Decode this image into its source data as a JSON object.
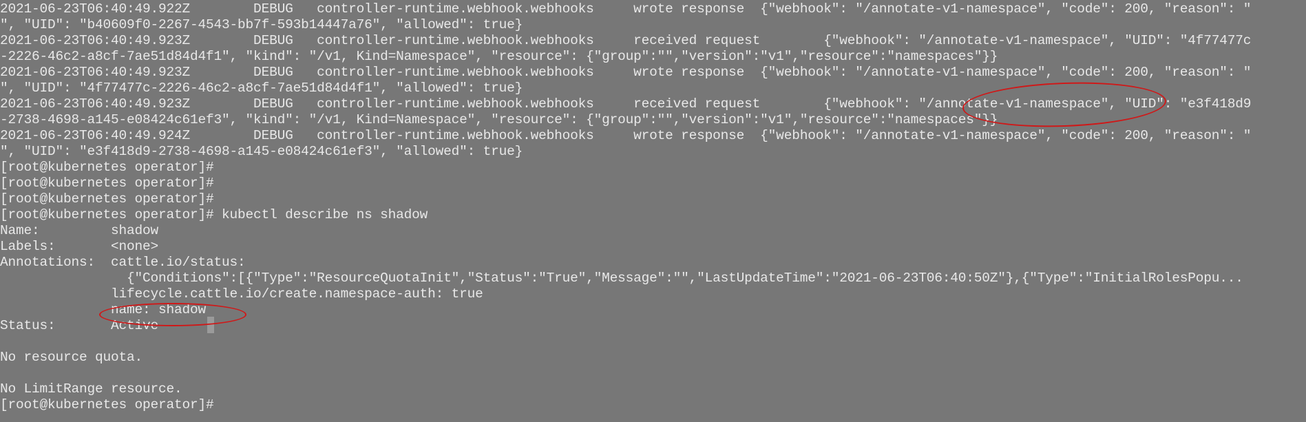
{
  "terminal": {
    "lines": [
      "2021-06-23T06:40:49.922Z        DEBUG   controller-runtime.webhook.webhooks     wrote response  {\"webhook\": \"/annotate-v1-namespace\", \"code\": 200, \"reason\": \"",
      "\", \"UID\": \"b40609f0-2267-4543-bb7f-593b14447a76\", \"allowed\": true}",
      "2021-06-23T06:40:49.923Z        DEBUG   controller-runtime.webhook.webhooks     received request        {\"webhook\": \"/annotate-v1-namespace\", \"UID\": \"4f77477c",
      "-2226-46c2-a8cf-7ae51d84d4f1\", \"kind\": \"/v1, Kind=Namespace\", \"resource\": {\"group\":\"\",\"version\":\"v1\",\"resource\":\"namespaces\"}}",
      "2021-06-23T06:40:49.923Z        DEBUG   controller-runtime.webhook.webhooks     wrote response  {\"webhook\": \"/annotate-v1-namespace\", \"code\": 200, \"reason\": \"",
      "\", \"UID\": \"4f77477c-2226-46c2-a8cf-7ae51d84d4f1\", \"allowed\": true}",
      "2021-06-23T06:40:49.923Z        DEBUG   controller-runtime.webhook.webhooks     received request        {\"webhook\": \"/annotate-v1-namespace\", \"UID\": \"e3f418d9",
      "-2738-4698-a145-e08424c61ef3\", \"kind\": \"/v1, Kind=Namespace\", \"resource\": {\"group\":\"\",\"version\":\"v1\",\"resource\":\"namespaces\"}}",
      "2021-06-23T06:40:49.924Z        DEBUG   controller-runtime.webhook.webhooks     wrote response  {\"webhook\": \"/annotate-v1-namespace\", \"code\": 200, \"reason\": \"",
      "\", \"UID\": \"e3f418d9-2738-4698-a145-e08424c61ef3\", \"allowed\": true}",
      "[root@kubernetes operator]#",
      "[root@kubernetes operator]#",
      "[root@kubernetes operator]#",
      "[root@kubernetes operator]# kubectl describe ns shadow",
      "Name:         shadow",
      "Labels:       <none>",
      "Annotations:  cattle.io/status:",
      "                {\"Conditions\":[{\"Type\":\"ResourceQuotaInit\",\"Status\":\"True\",\"Message\":\"\",\"LastUpdateTime\":\"2021-06-23T06:40:50Z\"},{\"Type\":\"InitialRolesPopu...",
      "              lifecycle.cattle.io/create.namespace-auth: true",
      "              name: shadow",
      "Status:       Active",
      "",
      "No resource quota.",
      "",
      "No LimitRange resource.",
      "[root@kubernetes operator]#"
    ]
  }
}
